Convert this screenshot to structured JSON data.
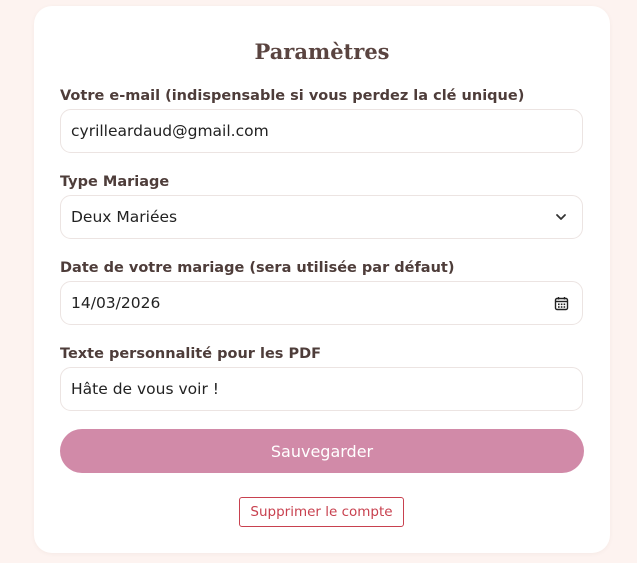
{
  "settings": {
    "title": "Paramètres",
    "email": {
      "label": "Votre e-mail (indispensable si vous perdez la clé unique)",
      "value": "cyrilleardaud@gmail.com"
    },
    "wedding_type": {
      "label": "Type Mariage",
      "selected": "Deux Mariées",
      "icon": "chevron-down-icon"
    },
    "wedding_date": {
      "label": "Date de votre mariage (sera utilisée par défaut)",
      "value": "14/03/2026",
      "icon": "calendar-icon"
    },
    "pdf_text": {
      "label": "Texte personnalité pour les PDF",
      "value": "Hâte de vous voir !"
    },
    "save_label": "Sauvegarder",
    "delete_label": "Supprimer le compte"
  },
  "colors": {
    "page_background": "#fdf3f0",
    "card_background": "#ffffff",
    "title_text": "#5a4440",
    "accent": "#d18aa8",
    "danger": "#c8414f"
  }
}
